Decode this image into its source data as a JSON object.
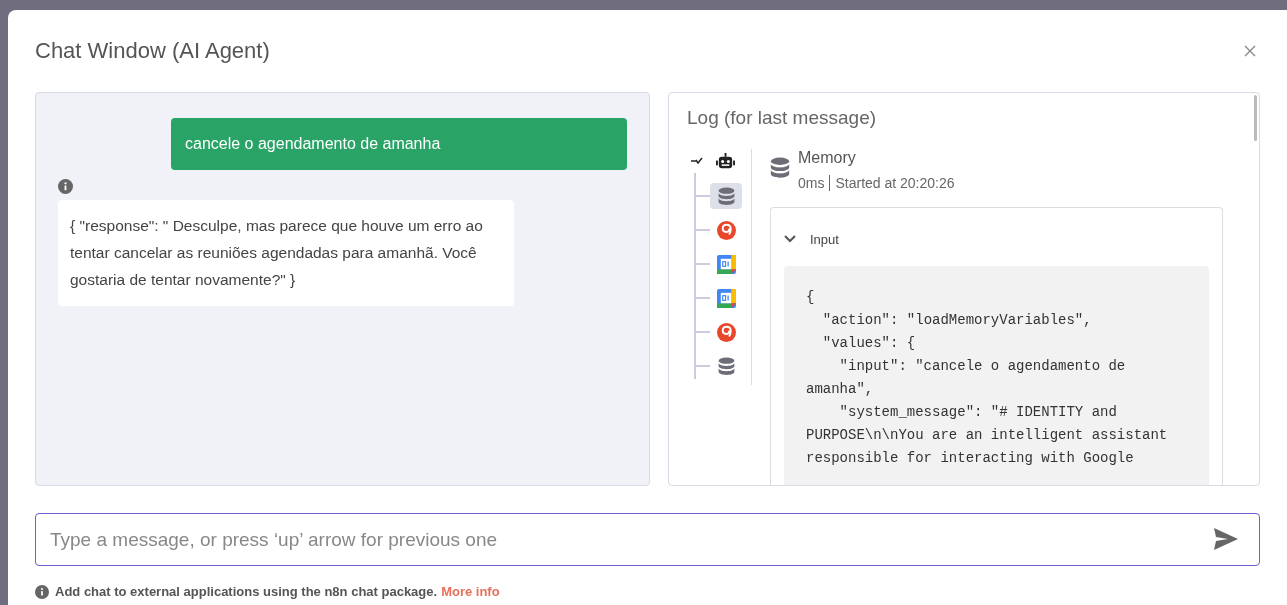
{
  "window": {
    "title": "Chat Window (AI Agent)"
  },
  "chat": {
    "messages": [
      {
        "kind": "user",
        "text": "cancele o agendamento de amanha"
      },
      {
        "kind": "bot",
        "text": "{ \"response\": \" Desculpe, mas parece que houve um erro ao tentar cancelar as reuniões agendadas para amanhã. Você gostaria de tentar novamente?\" }"
      }
    ]
  },
  "log": {
    "title": "Log (for last message)",
    "tree": [
      {
        "kind": "agent",
        "selected": false,
        "expanded": true,
        "children": [
          {
            "kind": "memory",
            "selected": true
          },
          {
            "kind": "serp",
            "selected": false
          },
          {
            "kind": "calendar",
            "selected": false
          },
          {
            "kind": "calendar",
            "selected": false
          },
          {
            "kind": "serp",
            "selected": false
          },
          {
            "kind": "memory",
            "selected": false
          }
        ]
      }
    ],
    "detail": {
      "kind": "memory",
      "name": "Memory",
      "duration": "0ms",
      "started": "Started at 20:20:26",
      "section": {
        "label": "Input",
        "expanded": true,
        "code": "{\n  \"action\": \"loadMemoryVariables\",\n  \"values\": {\n    \"input\": \"cancele o agendamento de amanha\",\n    \"system_message\": \"# IDENTITY and PURPOSE\\n\\nYou are an intelligent assistant responsible for interacting with Google"
      }
    }
  },
  "composer": {
    "placeholder": "Type a message, or press ‘up’ arrow for previous one"
  },
  "footer": {
    "text": "Add chat to external applications using the n8n chat package.",
    "link": "More info"
  }
}
